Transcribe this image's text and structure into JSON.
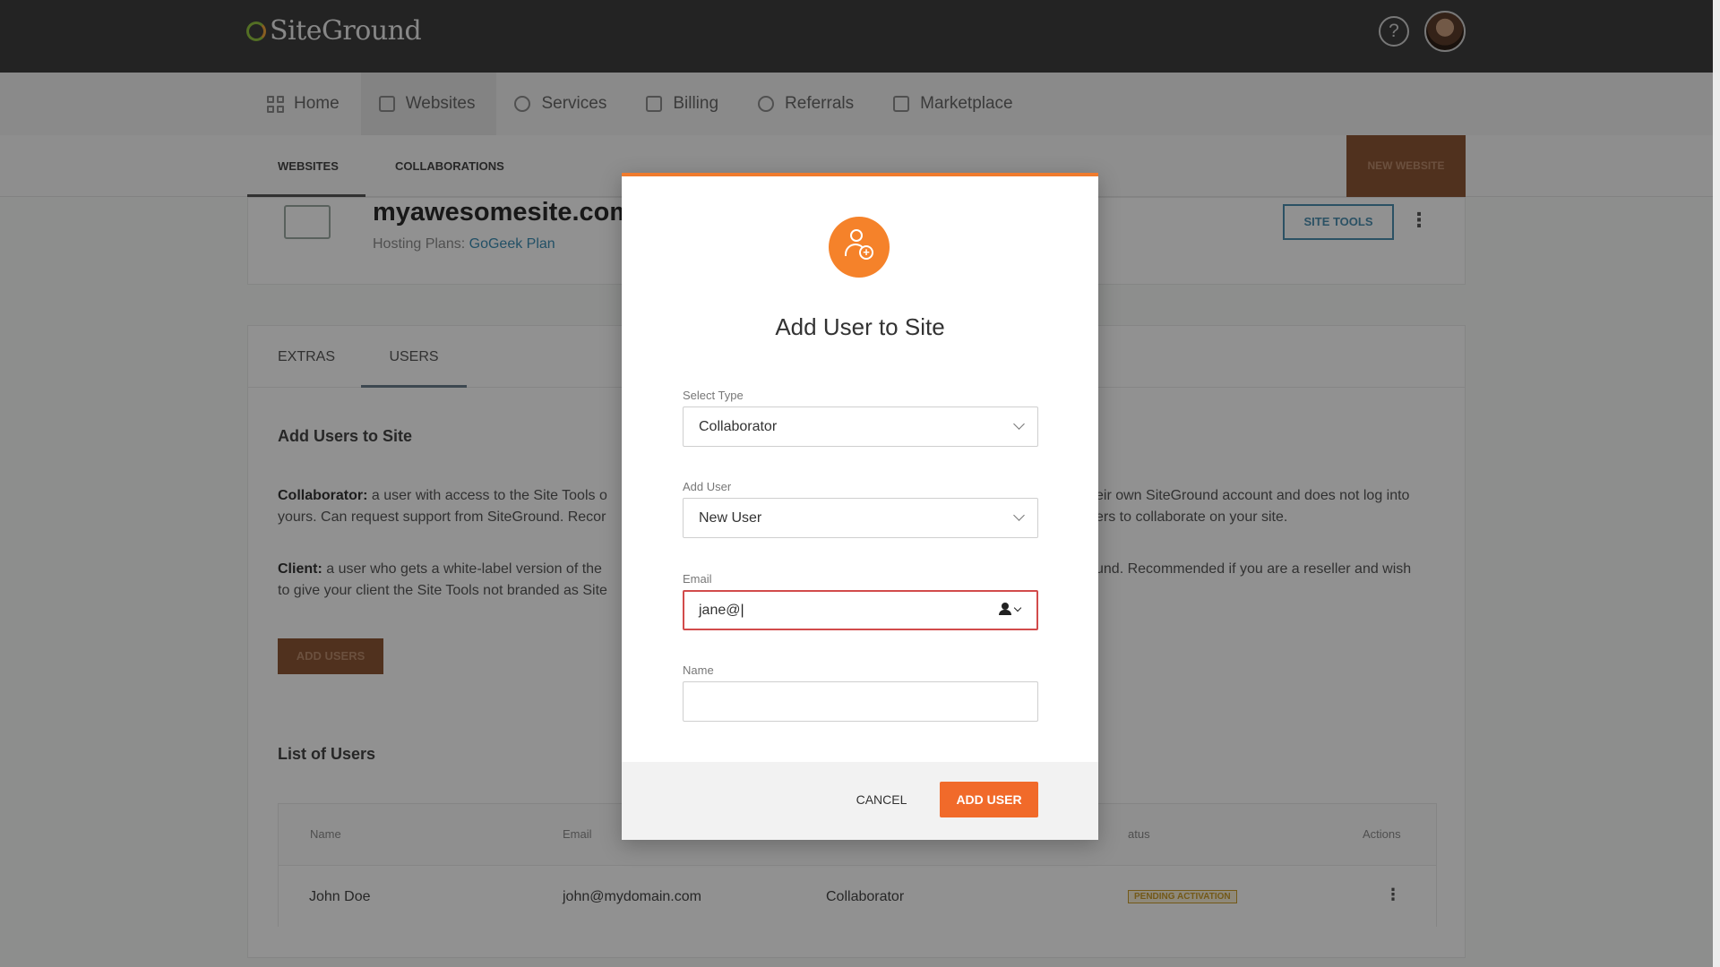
{
  "topbar": {
    "logo_text": "SiteGround",
    "help_glyph": "?"
  },
  "nav": {
    "items": [
      {
        "label": "Home",
        "icon": "grid-icon"
      },
      {
        "label": "Websites",
        "icon": "website-icon"
      },
      {
        "label": "Services",
        "icon": "services-icon"
      },
      {
        "label": "Billing",
        "icon": "billing-icon"
      },
      {
        "label": "Referrals",
        "icon": "referrals-icon"
      },
      {
        "label": "Marketplace",
        "icon": "marketplace-icon"
      }
    ],
    "active": "Websites"
  },
  "subnav": {
    "tabs": [
      "WEBSITES",
      "COLLABORATIONS"
    ],
    "new_website": "NEW WEBSITE"
  },
  "site": {
    "name": "myawesomesite.com",
    "plan_label": "Hosting Plans:",
    "plan_name": "GoGeek Plan",
    "site_tools": "SITE TOOLS"
  },
  "users_section": {
    "tabs": [
      "EXTRAS",
      "USERS"
    ],
    "title": "Add Users to Site",
    "collab_term": "Collaborator:",
    "collab_text": " a user with access to the Site Tools o",
    "collab_text_right": "eir own SiteGround account and does not log into",
    "collab_text_line2": "yours. Can request support from SiteGround. Recor",
    "collab_text_line2_right": "ers to collaborate on your site.",
    "client_term": "Client:",
    "client_text": " a user who gets a white-label version of the",
    "client_text_right": "und. Recommended if you are a reseller and wish",
    "client_text_line2": "to give your client the Site Tools not branded as Site",
    "add_users_button": "ADD USERS",
    "list_title": "List of Users",
    "columns": [
      "Name",
      "Email",
      "",
      "atus",
      "Actions"
    ],
    "rows": [
      {
        "name": "John Doe",
        "email": "john@mydomain.com",
        "role": "Collaborator",
        "status": "PENDING ACTIVATION"
      }
    ]
  },
  "modal": {
    "title": "Add User to Site",
    "select_type_label": "Select Type",
    "select_type_value": "Collaborator",
    "add_user_label": "Add User",
    "add_user_value": "New User",
    "email_label": "Email",
    "email_value": "jane@",
    "name_label": "Name",
    "name_value": "",
    "cancel": "CANCEL",
    "submit": "ADD USER"
  },
  "colors": {
    "accent": "#f16a2a",
    "topbar": "#3d3d3d",
    "error": "#d24b4b",
    "link": "#3b8ab0"
  }
}
